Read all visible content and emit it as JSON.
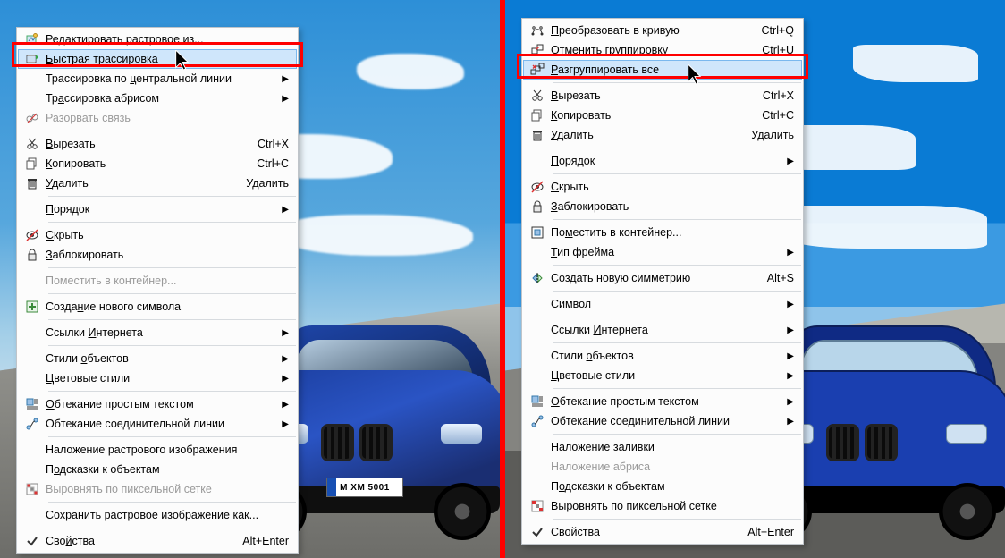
{
  "plate_text": "M  XM 5001",
  "left_menu": [
    {
      "type": "item",
      "icon": "edit-bitmap-icon",
      "label": "Редактировать растровое из...",
      "ul": "Р"
    },
    {
      "type": "item",
      "icon": "quick-trace-icon",
      "label": "Быстрая трассировка",
      "ul": "Б",
      "hovered": true
    },
    {
      "type": "item",
      "icon": "",
      "label": "Трассировка по центральной линии",
      "ul": "ц",
      "sub": true
    },
    {
      "type": "item",
      "icon": "",
      "label": "Трассировка абрисом",
      "ul": "а",
      "sub": true
    },
    {
      "type": "item",
      "icon": "break-link-icon",
      "label": "Разорвать связь",
      "disabled": true
    },
    {
      "type": "sep"
    },
    {
      "type": "item",
      "icon": "cut-icon",
      "label": "Вырезать",
      "ul": "В",
      "shortcut": "Ctrl+X"
    },
    {
      "type": "item",
      "icon": "copy-icon",
      "label": "Копировать",
      "ul": "К",
      "shortcut": "Ctrl+C"
    },
    {
      "type": "item",
      "icon": "delete-icon",
      "label": "Удалить",
      "ul": "У",
      "shortcut": "Удалить"
    },
    {
      "type": "sep"
    },
    {
      "type": "item",
      "icon": "",
      "label": "Порядок",
      "ul": "П",
      "sub": true
    },
    {
      "type": "sep"
    },
    {
      "type": "item",
      "icon": "hide-icon",
      "label": "Скрыть",
      "ul": "С"
    },
    {
      "type": "item",
      "icon": "lock-icon",
      "label": "Заблокировать",
      "ul": "З"
    },
    {
      "type": "sep"
    },
    {
      "type": "item",
      "icon": "",
      "label": "Поместить в контейнер...",
      "disabled": true
    },
    {
      "type": "sep"
    },
    {
      "type": "item",
      "icon": "new-symbol-icon",
      "label": "Создание нового символа",
      "ul": "н"
    },
    {
      "type": "sep"
    },
    {
      "type": "item",
      "icon": "",
      "label": "Ссылки Интернета",
      "ul": "И",
      "sub": true
    },
    {
      "type": "sep"
    },
    {
      "type": "item",
      "icon": "",
      "label": "Стили объектов",
      "ul": "о",
      "sub": true
    },
    {
      "type": "item",
      "icon": "",
      "label": "Цветовые стили",
      "ul": "Ц",
      "sub": true
    },
    {
      "type": "sep"
    },
    {
      "type": "item",
      "icon": "wrap-text-icon",
      "label": "Обтекание простым текстом",
      "ul": "О",
      "sub": true
    },
    {
      "type": "item",
      "icon": "connector-wrap-icon",
      "label": "Обтекание соединительной линии",
      "sub": true
    },
    {
      "type": "sep"
    },
    {
      "type": "item",
      "icon": "",
      "label": "Наложение растрового изображения"
    },
    {
      "type": "item",
      "icon": "",
      "label": "Подсказки к объектам",
      "ul": "о"
    },
    {
      "type": "item",
      "icon": "pixel-align-icon",
      "label": "Выровнять по пиксельной сетке",
      "disabled": true
    },
    {
      "type": "sep"
    },
    {
      "type": "item",
      "icon": "",
      "label": "Сохранить растровое изображение как...",
      "ul": "х"
    },
    {
      "type": "sep"
    },
    {
      "type": "item",
      "icon": "check-icon",
      "label": "Свойства",
      "ul": "й",
      "shortcut": "Alt+Enter"
    }
  ],
  "right_menu": [
    {
      "type": "item",
      "icon": "to-curve-icon",
      "label": "Преобразовать в кривую",
      "ul": "П",
      "shortcut": "Ctrl+Q"
    },
    {
      "type": "item",
      "icon": "ungroup-icon",
      "label": "Отменить группировку",
      "ul": "О",
      "shortcut": "Ctrl+U"
    },
    {
      "type": "item",
      "icon": "ungroup-all-icon",
      "label": "Разгруппировать все",
      "ul": "Р",
      "hovered": true
    },
    {
      "type": "sep"
    },
    {
      "type": "item",
      "icon": "cut-icon",
      "label": "Вырезать",
      "ul": "В",
      "shortcut": "Ctrl+X"
    },
    {
      "type": "item",
      "icon": "copy-icon",
      "label": "Копировать",
      "ul": "К",
      "shortcut": "Ctrl+C"
    },
    {
      "type": "item",
      "icon": "delete-icon",
      "label": "Удалить",
      "ul": "У",
      "shortcut": "Удалить"
    },
    {
      "type": "sep"
    },
    {
      "type": "item",
      "icon": "",
      "label": "Порядок",
      "ul": "П",
      "sub": true
    },
    {
      "type": "sep"
    },
    {
      "type": "item",
      "icon": "hide-icon",
      "label": "Скрыть",
      "ul": "С"
    },
    {
      "type": "item",
      "icon": "lock-icon",
      "label": "Заблокировать",
      "ul": "З"
    },
    {
      "type": "sep"
    },
    {
      "type": "item",
      "icon": "powerclip-icon",
      "label": "Поместить в контейнер...",
      "ul": "м"
    },
    {
      "type": "item",
      "icon": "",
      "label": "Тип фрейма",
      "ul": "Т",
      "sub": true
    },
    {
      "type": "sep"
    },
    {
      "type": "item",
      "icon": "symmetry-icon",
      "label": "Создать новую симметрию",
      "shortcut": "Alt+S"
    },
    {
      "type": "sep"
    },
    {
      "type": "item",
      "icon": "",
      "label": "Символ",
      "ul": "С",
      "sub": true
    },
    {
      "type": "sep"
    },
    {
      "type": "item",
      "icon": "",
      "label": "Ссылки Интернета",
      "ul": "И",
      "sub": true
    },
    {
      "type": "sep"
    },
    {
      "type": "item",
      "icon": "",
      "label": "Стили объектов",
      "ul": "о",
      "sub": true
    },
    {
      "type": "item",
      "icon": "",
      "label": "Цветовые стили",
      "ul": "Ц",
      "sub": true
    },
    {
      "type": "sep"
    },
    {
      "type": "item",
      "icon": "wrap-text-icon",
      "label": "Обтекание простым текстом",
      "ul": "О",
      "sub": true
    },
    {
      "type": "item",
      "icon": "connector-wrap-icon",
      "label": "Обтекание соединительной линии",
      "sub": true
    },
    {
      "type": "sep"
    },
    {
      "type": "item",
      "icon": "",
      "label": "Наложение заливки"
    },
    {
      "type": "item",
      "icon": "",
      "label": "Наложение абриса",
      "disabled": true
    },
    {
      "type": "item",
      "icon": "",
      "label": "Подсказки к объектам",
      "ul": "о"
    },
    {
      "type": "item",
      "icon": "pixel-align-icon",
      "label": "Выровнять по пиксельной сетке",
      "ul": "е"
    },
    {
      "type": "sep"
    },
    {
      "type": "item",
      "icon": "check-icon",
      "label": "Свойства",
      "ul": "й",
      "shortcut": "Alt+Enter"
    }
  ]
}
